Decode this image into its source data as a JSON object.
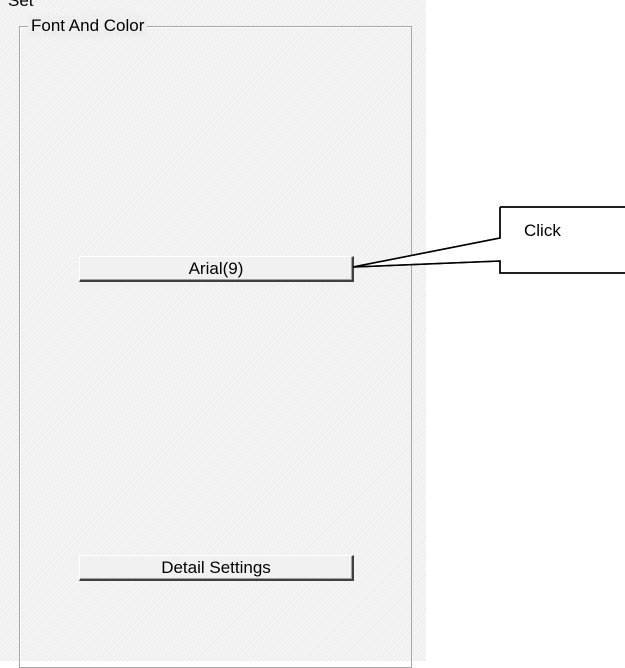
{
  "panel": {
    "set_label": "Set",
    "group_title": "Font And Color",
    "font_button_label": "Arial(9)",
    "detail_button_label": "Detail Settings"
  },
  "callout": {
    "text": "Click"
  }
}
